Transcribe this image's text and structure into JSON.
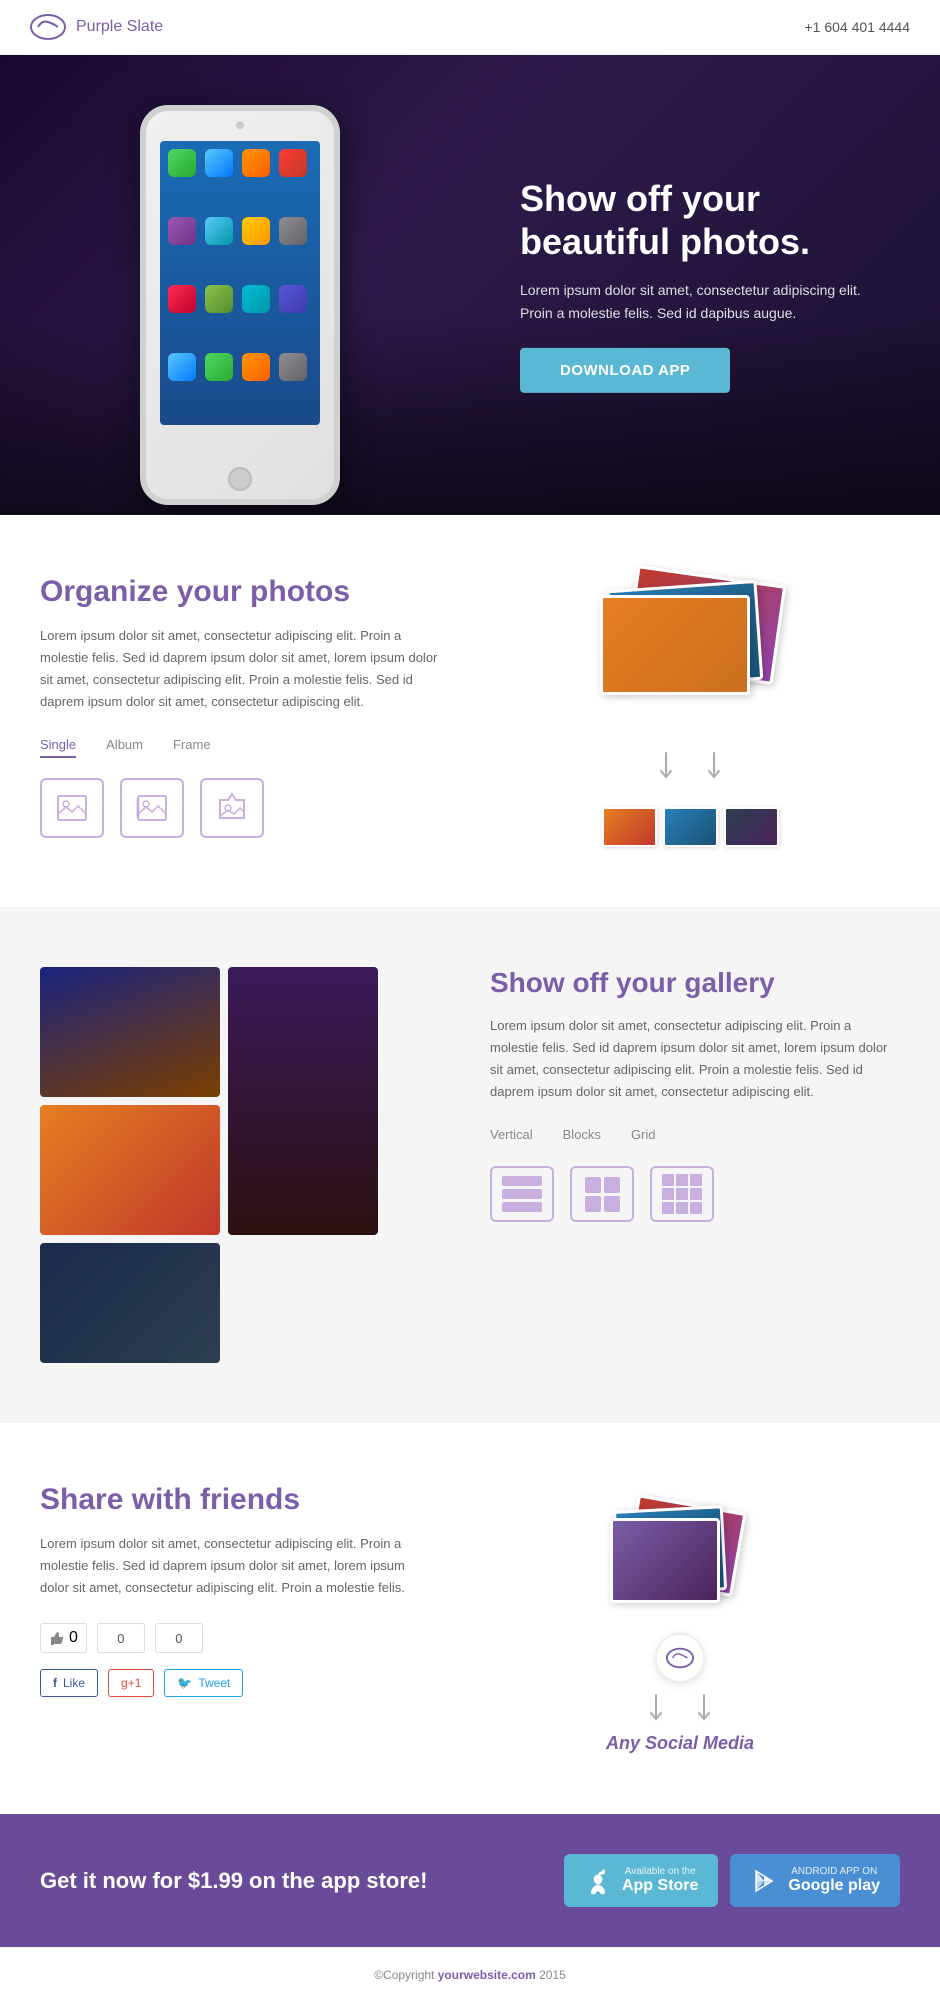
{
  "header": {
    "logo_text": "Purple Slate",
    "phone": "+1 604 401 4444"
  },
  "hero": {
    "title": "Show off your beautiful photos.",
    "description": "Lorem ipsum dolor sit amet, consectetur adipiscing elit. Proin a molestie felis. Sed id dapibus augue.",
    "cta_button": "Download App"
  },
  "organize": {
    "title": "Organize your photos",
    "description": "Lorem ipsum dolor sit amet, consectetur adipiscing elit. Proin a molestie felis. Sed id daprem ipsum dolor sit amet, lorem ipsum dolor sit amet, consectetur adipiscing elit. Proin a molestie felis. Sed id daprem ipsum dolor sit amet, consectetur adipiscing elit.",
    "tabs": [
      {
        "label": "Single",
        "active": true
      },
      {
        "label": "Album",
        "active": false
      },
      {
        "label": "Frame",
        "active": false
      }
    ]
  },
  "gallery": {
    "title": "Show off your gallery",
    "description": "Lorem ipsum dolor sit amet, consectetur adipiscing elit. Proin a molestie felis. Sed id daprem ipsum dolor sit amet, lorem ipsum dolor sit amet, consectetur adipiscing elit. Proin a molestie felis. Sed id daprem ipsum dolor sit amet, consectetur adipiscing elit.",
    "tabs": [
      {
        "label": "Vertical"
      },
      {
        "label": "Blocks"
      },
      {
        "label": "Grid"
      }
    ]
  },
  "share": {
    "title": "Share with friends",
    "description": "Lorem ipsum dolor sit amet, consectetur adipiscing elit. Proin a molestie felis. Sed id daprem ipsum dolor sit amet, lorem ipsum dolor sit amet, consectetur adipiscing elit. Proin a molestie felis.",
    "counts": [
      "0",
      "0",
      "0"
    ],
    "buttons": [
      {
        "label": "Like",
        "platform": "facebook"
      },
      {
        "label": "g+1",
        "platform": "google"
      },
      {
        "label": "Tweet",
        "platform": "twitter"
      }
    ],
    "any_social": "Any Social Media"
  },
  "cta": {
    "text": "Get it now for $1.99 on the app store!",
    "appstore": {
      "sub": "Available on the",
      "main": "App Store"
    },
    "googleplay": {
      "sub": "ANDROID APP ON",
      "main": "Google play"
    }
  },
  "footer": {
    "copyright": "©Copyright ",
    "website": "yourwebsite.com",
    "year": " 2015"
  }
}
